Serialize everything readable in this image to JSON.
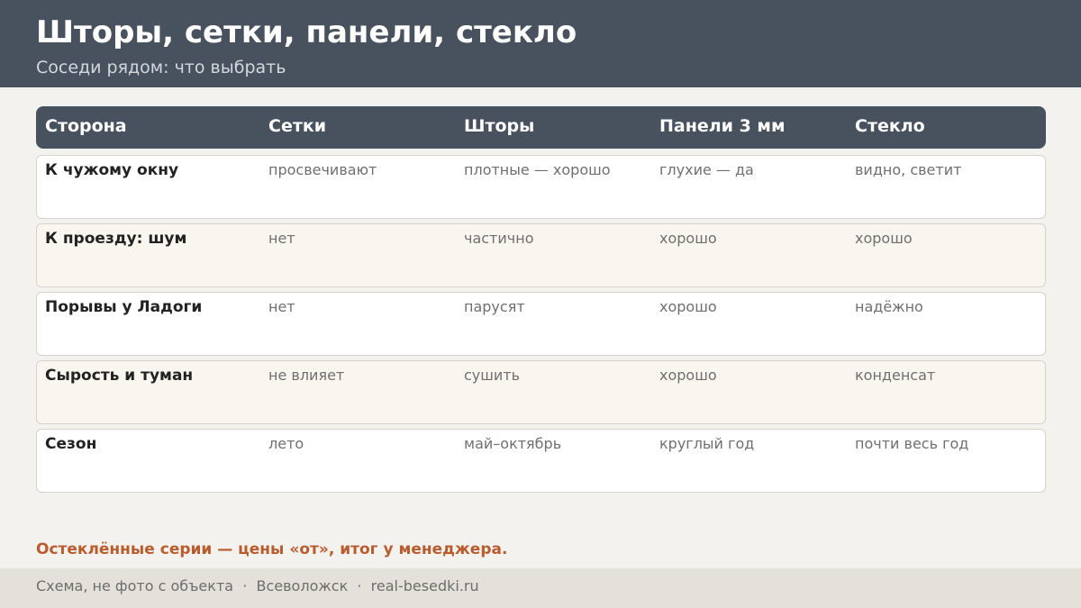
{
  "header": {
    "title": "Шторы, сетки, панели, стекло",
    "subtitle": "Соседи рядом: что выбрать"
  },
  "table": {
    "columns": [
      "Сторона",
      "Сетки",
      "Шторы",
      "Панели 3 мм",
      "Стекло"
    ],
    "rows": [
      [
        "К чужому окну",
        "просвечивают",
        "плотные — хорошо",
        "глухие — да",
        "видно, светит"
      ],
      [
        "К проезду: шум",
        "нет",
        "частично",
        "хорошо",
        "хорошо"
      ],
      [
        "Порывы у Ладоги",
        "нет",
        "парусят",
        "хорошо",
        "надёжно"
      ],
      [
        "Сырость и туман",
        "не влияет",
        "сушить",
        "хорошо",
        "конденсат"
      ],
      [
        "Сезон",
        "лето",
        "май–октябрь",
        "круглый год",
        "почти весь год"
      ]
    ]
  },
  "note": "Остеклённые серии — цены «от», итог у менеджера.",
  "footer": {
    "caption": "Схема, не фото с объекта",
    "separator": "·",
    "city": "Всеволожск",
    "site": "real-besedki.ru"
  },
  "colors": {
    "header_bg": "#48515e",
    "accent": "#b85c2e",
    "page_bg": "#f4f2ee"
  }
}
